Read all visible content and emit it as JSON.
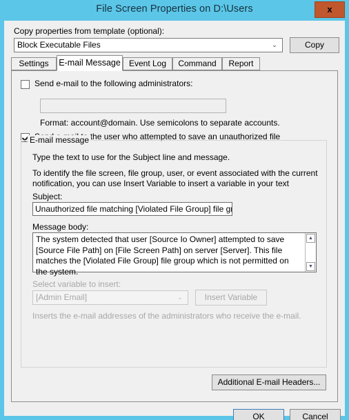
{
  "window": {
    "title": "File Screen Properties on D:\\Users",
    "close_label": "x",
    "titlebar_color": "#5bc6e8",
    "close_button_color": "#c0572d",
    "body_color": "#efefef"
  },
  "template": {
    "label": "Copy properties from template (optional):",
    "selected": "Block Executable Files",
    "dropdown_arrow": "⌄",
    "copy_label": "Copy"
  },
  "tabs": [
    {
      "label": "Settings",
      "active": false
    },
    {
      "label": "E-mail Message",
      "active": true
    },
    {
      "label": "Event Log",
      "active": false
    },
    {
      "label": "Command",
      "active": false
    },
    {
      "label": "Report",
      "active": false
    }
  ],
  "admin_section": {
    "checkbox_label": "Send e-mail to the following administrators:",
    "checked": false,
    "input_value": "",
    "format_hint": "Format: account@domain. Use semicolons to separate accounts."
  },
  "user_section": {
    "checkbox_label": "Send e-mail to the user who attempted to save an unauthorized file",
    "checked": true
  },
  "email_group": {
    "title": "E-mail message",
    "intro_line1": "Type the text to use for the Subject line and message.",
    "intro_line2": "To identify the file screen, file group, user, or event associated with the current",
    "intro_line3": "notification, you can use Insert Variable to insert a variable in your text",
    "subject_label": "Subject:",
    "subject_value": "Unauthorized file matching [Violated File Group] file group detected",
    "body_label": "Message body:",
    "body_value": "The system detected that user [Source Io Owner] attempted to save [Source File Path] on [File Screen Path] on server [Server]. This file matches the [Violated File Group] file group which is not permitted on the system.",
    "scroll_up": "▲",
    "scroll_down": "▼",
    "variable_label": "Select variable to insert:",
    "variable_selected": "[Admin Email]",
    "insert_button": "Insert Variable",
    "variable_hint": "Inserts the e-mail addresses of the administrators who receive the e-mail."
  },
  "footer": {
    "additional_headers": "Additional E-mail Headers...",
    "ok": "OK",
    "cancel": "Cancel"
  }
}
